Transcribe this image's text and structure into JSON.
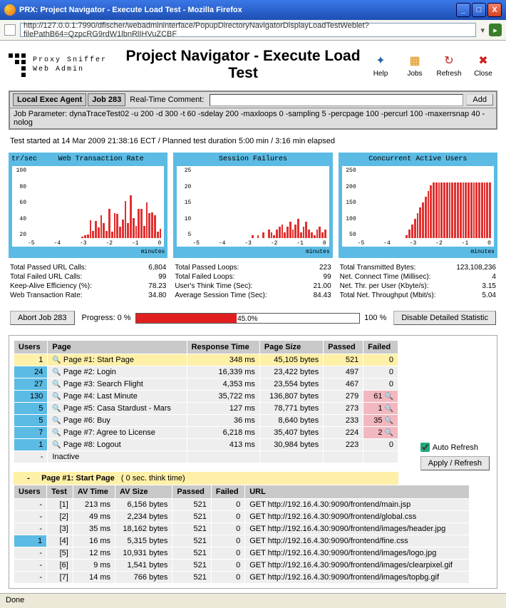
{
  "window": {
    "title": "PRX: Project Navigator - Execute Load Test - Mozilla Firefox",
    "url": "http://127.0.0.1:7990/dfischer/webadmininterface/PopupDirectoryNavigatorDisplayLoadTestWeblet?filePathB64=QzpcRG9rdW1lbnRlIHVuZCBF",
    "minimize": "_",
    "maximize": "□",
    "close": "X"
  },
  "brand": {
    "l1": "Proxy Sniffer",
    "l2": "Web Admin"
  },
  "page_title": "Project Navigator - Execute Load Test",
  "tools": {
    "help": "Help",
    "jobs": "Jobs",
    "refresh": "Refresh",
    "close": "Close"
  },
  "strip": {
    "agent": "Local Exec Agent",
    "job": "Job 283",
    "rtc_label": "Real-Time Comment:",
    "add": "Add",
    "params": "Job Parameter: dynaTraceTest02 -u 200 -d 300 -t 60 -sdelay 200 -maxloops 0 -sampling 5 -percpage 100 -percurl 100 -maxerrsnap 40 -nolog"
  },
  "status": "Test started at 14 Mar 2009 21:38:16 ECT  /  Planned test duration 5:00 min  /  3:16 min elapsed",
  "chart_data": [
    {
      "type": "bar",
      "title": "Web Transaction Rate",
      "ylabel": "tr/sec",
      "xlabel": "minutes",
      "x": [
        -5,
        -4,
        -3,
        -2,
        -1,
        0
      ],
      "ylim": [
        0,
        100
      ],
      "yticks": [
        20,
        40,
        60,
        80,
        100
      ],
      "values": [
        0,
        0,
        0,
        0,
        0,
        0,
        0,
        0,
        0,
        0,
        0,
        0,
        0,
        0,
        0,
        0,
        0,
        0,
        0,
        0,
        2,
        4,
        5,
        26,
        10,
        25,
        15,
        33,
        22,
        10,
        42,
        9,
        36,
        35,
        16,
        27,
        54,
        22,
        62,
        29,
        18,
        42,
        42,
        18,
        52,
        36,
        37,
        33,
        9,
        13
      ]
    },
    {
      "type": "bar",
      "title": "Session Failures",
      "ylabel": "",
      "xlabel": "minutes",
      "x": [
        -5,
        -4,
        -3,
        -2,
        -1,
        0
      ],
      "ylim": [
        0,
        25
      ],
      "yticks": [
        5,
        10,
        15,
        20,
        25
      ],
      "values": [
        0,
        0,
        0,
        0,
        0,
        0,
        0,
        0,
        0,
        0,
        0,
        0,
        0,
        0,
        0,
        0,
        0,
        0,
        0,
        0,
        0,
        0,
        1,
        0,
        1,
        0,
        2,
        0,
        3,
        2,
        1,
        3,
        4,
        5,
        2,
        4,
        6,
        3,
        5,
        7,
        2,
        4,
        6,
        3,
        2,
        1,
        3,
        4,
        2,
        3
      ]
    },
    {
      "type": "bar",
      "title": "Concurrent Active Users",
      "ylabel": "",
      "xlabel": "minutes",
      "x": [
        -5,
        -4,
        -3,
        -2,
        -1,
        0
      ],
      "ylim": [
        0,
        250
      ],
      "yticks": [
        50,
        100,
        150,
        200,
        250
      ],
      "values": [
        0,
        0,
        0,
        0,
        0,
        0,
        0,
        0,
        0,
        0,
        0,
        0,
        0,
        0,
        0,
        0,
        0,
        0,
        10,
        30,
        50,
        70,
        90,
        110,
        130,
        150,
        170,
        190,
        200,
        200,
        200,
        200,
        200,
        200,
        200,
        200,
        200,
        200,
        200,
        200,
        200,
        200,
        200,
        200,
        200,
        200,
        200,
        200,
        200,
        200
      ]
    }
  ],
  "stats": [
    [
      [
        "Total Passed URL Calls:",
        "6,804"
      ],
      [
        "Total Failed URL Calls:",
        "99"
      ],
      [
        "Keep-Alive Efficiency (%):",
        "78.23"
      ],
      [
        "Web Transaction Rate:",
        "34.80"
      ]
    ],
    [
      [
        "Total Passed Loops:",
        "223"
      ],
      [
        "Total Failed Loops:",
        "99"
      ],
      [
        "User's Think Time (Sec):",
        "21.00"
      ],
      [
        "Average Session Time (Sec):",
        "84.43"
      ]
    ],
    [
      [
        "Total Transmitted Bytes:",
        "123,108,236"
      ],
      [
        "Net. Connect Time (Millisec):",
        "4"
      ],
      [
        "Net. Thr. per User (Kbyte/s):",
        "3.15"
      ],
      [
        "Total Net. Throughput (Mbit/s):",
        "5.04"
      ]
    ]
  ],
  "abort": "Abort Job 283",
  "progress": {
    "label": "Progress: 0 %",
    "pct": 45,
    "pct_label": "45.0%",
    "end": "100 %"
  },
  "disable": "Disable Detailed Statistic",
  "table1": {
    "headers": [
      "Users",
      "Page",
      "Response Time",
      "Page Size",
      "Passed",
      "Failed"
    ],
    "rows": [
      {
        "u": "1",
        "p": "Page #1: Start Page",
        "rt": "348 ms",
        "ps": "45,105 bytes",
        "pa": "521",
        "fa": "0",
        "sel": true
      },
      {
        "u": "24",
        "p": "Page #2: Login",
        "rt": "16,339 ms",
        "ps": "23,422 bytes",
        "pa": "497",
        "fa": "0"
      },
      {
        "u": "27",
        "p": "Page #3: Search Flight",
        "rt": "4,353 ms",
        "ps": "23,554 bytes",
        "pa": "467",
        "fa": "0"
      },
      {
        "u": "130",
        "p": "Page #4: Last Minute",
        "rt": "35,722 ms",
        "ps": "136,807 bytes",
        "pa": "279",
        "fa": "61",
        "bad": true
      },
      {
        "u": "5",
        "p": "Page #5: Casa Stardust - Mars",
        "rt": "127 ms",
        "ps": "78,771 bytes",
        "pa": "273",
        "fa": "1",
        "bad": true
      },
      {
        "u": "5",
        "p": "Page #6: Buy",
        "rt": "36 ms",
        "ps": "8,640 bytes",
        "pa": "233",
        "fa": "35",
        "bad": true
      },
      {
        "u": "7",
        "p": "Page #7: Agree to License",
        "rt": "6,218 ms",
        "ps": "35,407 bytes",
        "pa": "224",
        "fa": "2",
        "bad": true
      },
      {
        "u": "1",
        "p": "Page #8: Logout",
        "rt": "413 ms",
        "ps": "30,984 bytes",
        "pa": "223",
        "fa": "0"
      },
      {
        "u": "-",
        "p": "Inactive",
        "rt": "",
        "ps": "",
        "pa": "",
        "fa": "",
        "plain": true
      }
    ]
  },
  "auto_refresh": "Auto Refresh",
  "apply": "Apply / Refresh",
  "sub": {
    "title": "Page #1: Start Page",
    "think": "( 0 sec. think time)"
  },
  "table2": {
    "headers": [
      "Users",
      "Test",
      "AV Time",
      "AV Size",
      "Passed",
      "Failed",
      "URL"
    ],
    "rows": [
      {
        "u": "-",
        "t": "[1]",
        "at": "213 ms",
        "as": "6,156 bytes",
        "pa": "521",
        "fa": "0",
        "url": "GET http://192.16.4.30:9090/frontend/main.jsp"
      },
      {
        "u": "-",
        "t": "[2]",
        "at": "49 ms",
        "as": "2,234 bytes",
        "pa": "521",
        "fa": "0",
        "url": "GET http://192.16.4.30:9090/frontend/global.css"
      },
      {
        "u": "-",
        "t": "[3]",
        "at": "35 ms",
        "as": "18,162 bytes",
        "pa": "521",
        "fa": "0",
        "url": "GET http://192.16.4.30:9090/frontend/images/header.jpg"
      },
      {
        "u": "1",
        "t": "[4]",
        "at": "16 ms",
        "as": "5,315 bytes",
        "pa": "521",
        "fa": "0",
        "url": "GET http://192.16.4.30:9090/frontend/fine.css",
        "uc": true
      },
      {
        "u": "-",
        "t": "[5]",
        "at": "12 ms",
        "as": "10,931 bytes",
        "pa": "521",
        "fa": "0",
        "url": "GET http://192.16.4.30:9090/frontend/images/logo.jpg"
      },
      {
        "u": "-",
        "t": "[6]",
        "at": "9 ms",
        "as": "1,541 bytes",
        "pa": "521",
        "fa": "0",
        "url": "GET http://192.16.4.30:9090/frontend/images/clearpixel.gif"
      },
      {
        "u": "-",
        "t": "[7]",
        "at": "14 ms",
        "as": "766 bytes",
        "pa": "521",
        "fa": "0",
        "url": "GET http://192.16.4.30:9090/frontend/images/topbg.gif"
      }
    ]
  },
  "footer": "Done"
}
